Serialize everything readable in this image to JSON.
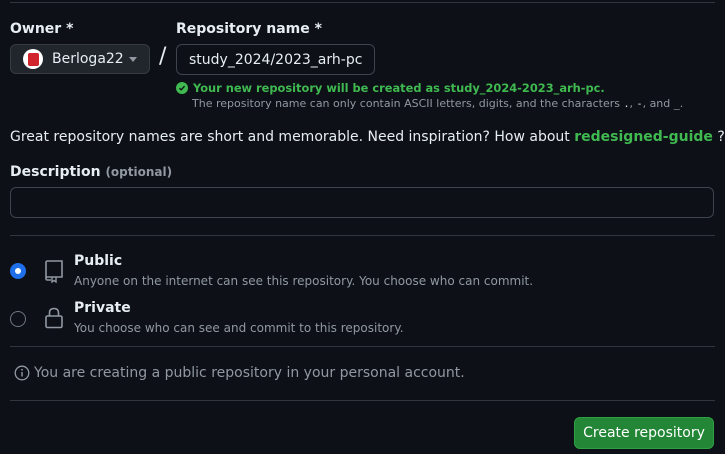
{
  "owner": {
    "label": "Owner *",
    "selected": "Berloga22"
  },
  "repo": {
    "label": "Repository name *",
    "value": "study_2024/2023_arh-pc",
    "separator": "/",
    "validation": "Your new repository will be created as study_2024-2023_arh-pc.",
    "hint_prefix": "The repository name can only contain ASCII letters, digits, and the characters ",
    "hint_chars": ".",
    "hint_sep1": ", ",
    "hint_chars2": "-",
    "hint_sep2": ", and ",
    "hint_chars3": "_",
    "hint_end": "."
  },
  "inspiration": {
    "prefix": "Great repository names are short and memorable. Need inspiration? How about ",
    "suggestion": "redesigned-guide",
    "suffix": " ?"
  },
  "description": {
    "label": "Description",
    "optional": "(optional)",
    "value": ""
  },
  "visibility": {
    "selected": "Public",
    "options": [
      {
        "title": "Public",
        "desc": "Anyone on the internet can see this repository. You choose who can commit.",
        "icon": "repo-book-icon"
      },
      {
        "title": "Private",
        "desc": "You choose who can see and commit to this repository.",
        "icon": "lock-icon"
      }
    ]
  },
  "info": {
    "text": "You are creating a public repository in your personal account.",
    "icon": "info-icon"
  },
  "create_button": "Create repository",
  "colors": {
    "background": "#0d1117",
    "accent_green": "#3fb950",
    "button_green": "#238636",
    "radio_blue": "#1f6feb",
    "muted_text": "#9198a1"
  }
}
